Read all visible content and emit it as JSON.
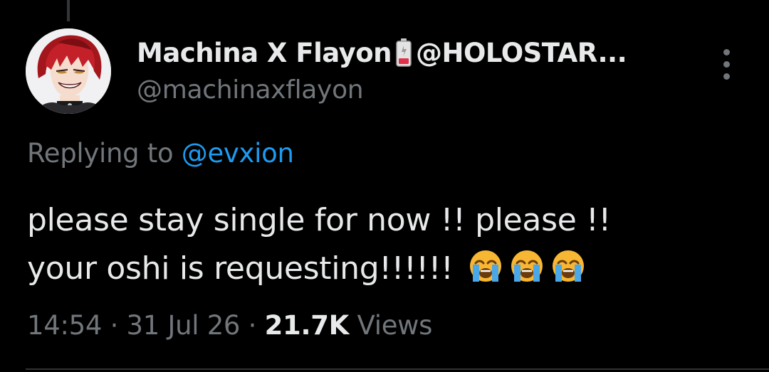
{
  "author": {
    "display_name": "Machina X Flayon",
    "name_emoji": "battery-low-icon",
    "name_suffix": "@HOLOSTAR...",
    "handle": "@machinaxflayon"
  },
  "reply": {
    "prefix": "Replying to",
    "mention": "@evxion"
  },
  "tweet": {
    "line1": "please stay single for now !! please !!",
    "line2": "your oshi is requesting!!!!!!",
    "emojis": [
      "loudly-crying-face-icon",
      "loudly-crying-face-icon",
      "loudly-crying-face-icon"
    ]
  },
  "meta": {
    "time": "14:54",
    "separator": "·",
    "date": "31 Jul 26",
    "views_count": "21.7K",
    "views_label": "Views"
  },
  "colors": {
    "background": "#000000",
    "primary_text": "#e7e9ea",
    "secondary_text": "#71767b",
    "accent": "#1d9bf0"
  }
}
